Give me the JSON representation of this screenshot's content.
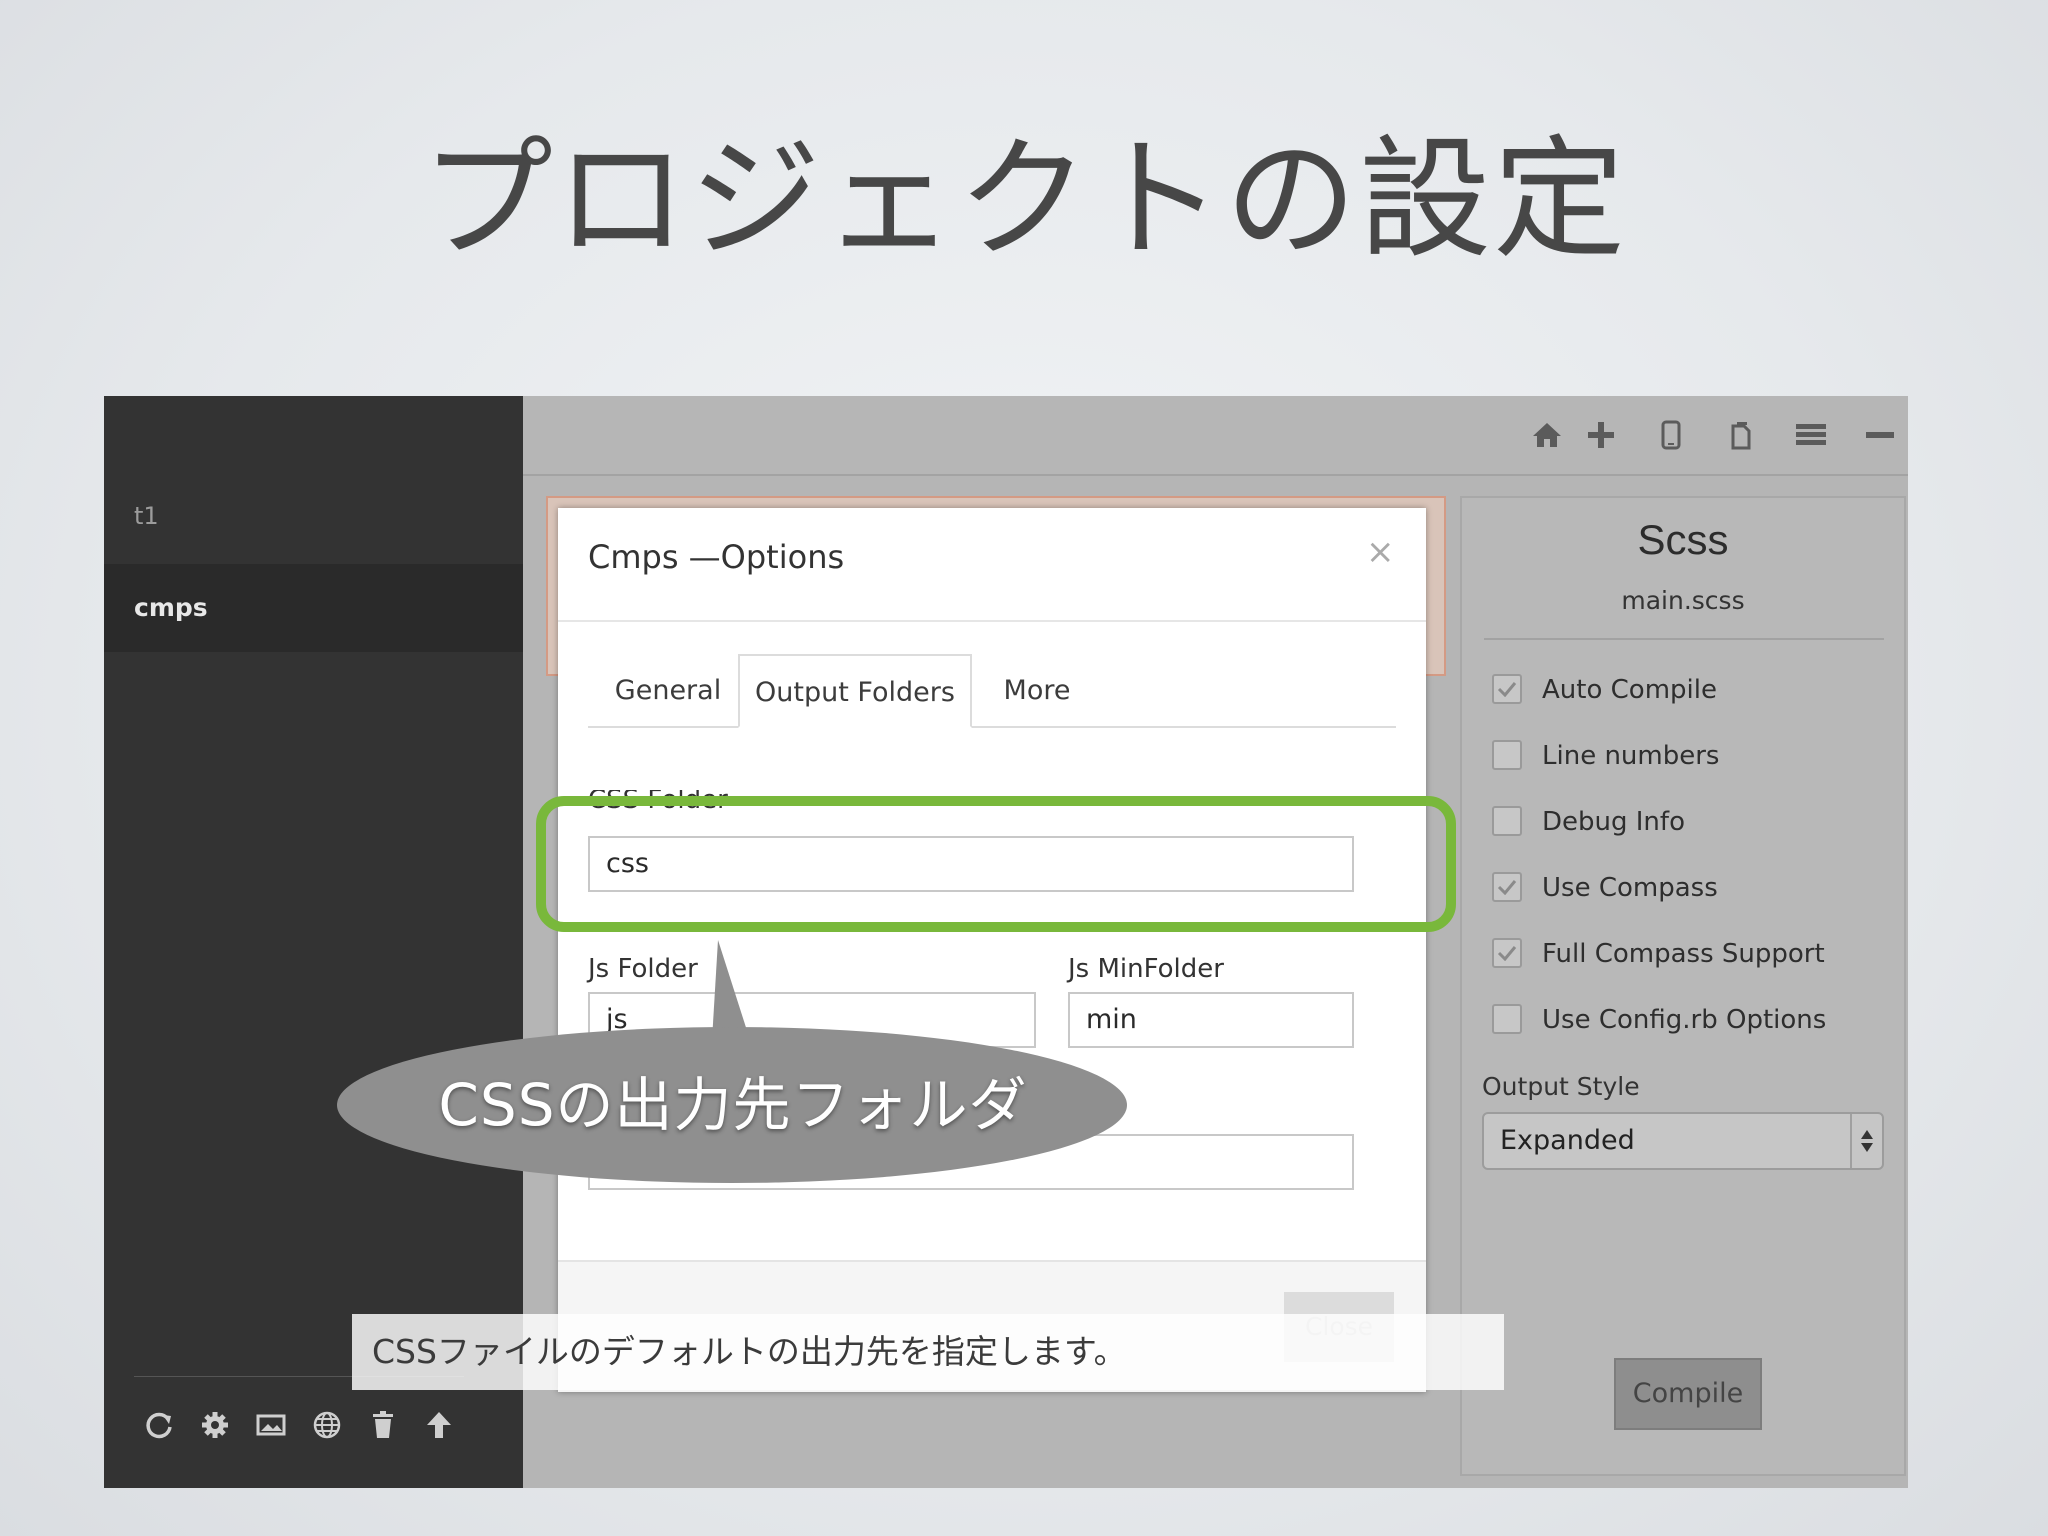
{
  "slide": {
    "title": "プロジェクトの設定"
  },
  "sidebar": {
    "projects": [
      {
        "name": "t1"
      },
      {
        "name": "cmps"
      }
    ],
    "tool_icons": [
      "refresh-icon",
      "gear-icon",
      "image-icon",
      "globe-icon",
      "trash-icon",
      "upload-icon"
    ]
  },
  "topbar": {
    "icons": [
      "home-icon",
      "plus-icon",
      "phone-icon",
      "copy-icon",
      "menu-icon",
      "minimize-icon",
      "close-icon"
    ]
  },
  "right_panel": {
    "title": "Scss",
    "file": "main.scss",
    "options": [
      {
        "label": "Auto Compile",
        "checked": true
      },
      {
        "label": "Line numbers",
        "checked": false
      },
      {
        "label": "Debug Info",
        "checked": false
      },
      {
        "label": "Use Compass",
        "checked": true
      },
      {
        "label": "Full Compass Support",
        "checked": true
      },
      {
        "label": "Use Config.rb Options",
        "checked": false
      }
    ],
    "output_style_label": "Output Style",
    "output_style_value": "Expanded",
    "compile_label": "Compile"
  },
  "dialog": {
    "title": "Cmps —Options",
    "close_symbol": "×",
    "tabs": [
      {
        "label": "General",
        "active": false
      },
      {
        "label": "Output Folders",
        "active": true
      },
      {
        "label": "More",
        "active": false
      }
    ],
    "fields": {
      "css_folder_label": "CSS Folder",
      "css_folder_value": "css",
      "js_folder_label": "Js Folder",
      "js_folder_value": "js",
      "js_min_folder_label": "Js MinFolder",
      "js_min_folder_value": "min",
      "fourth_value": ""
    },
    "close_button_label": "Close"
  },
  "annotations": {
    "callout": "CSSの出力先フォルダ",
    "caption": "CSSファイルのデフォルトの出力先を指定します。",
    "highlight_color": "#79b83b"
  }
}
